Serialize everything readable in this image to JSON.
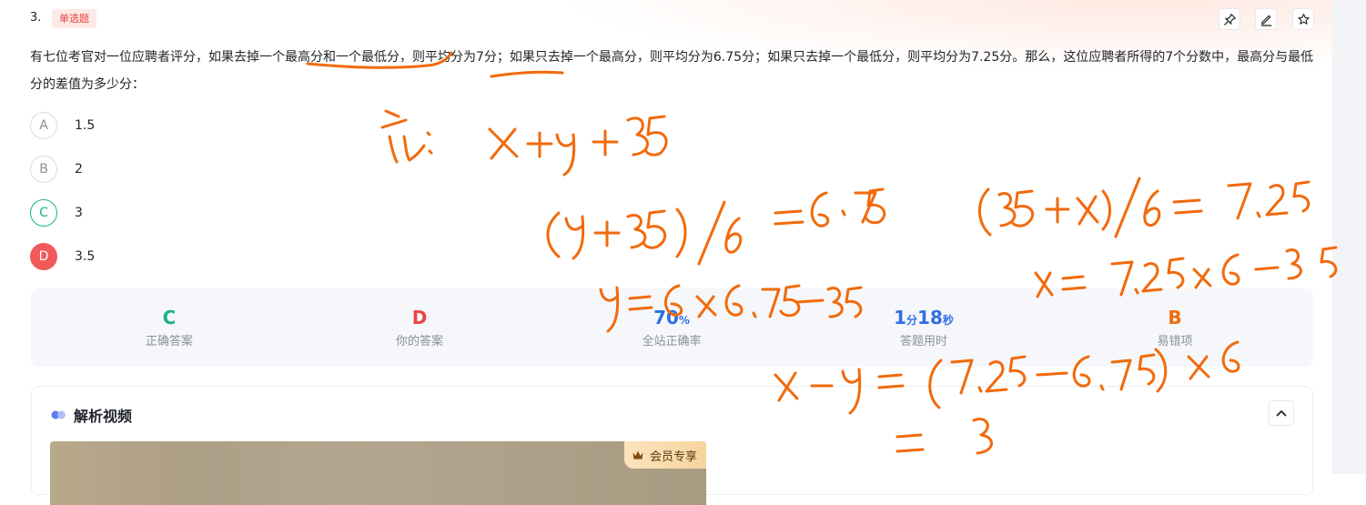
{
  "question": {
    "number": "3.",
    "type_tag": "单选题",
    "stem": "有七位考官对一位应聘者评分，如果去掉一个最高分和一个最低分，则平均分为7分；如果只去掉一个最高分，则平均分为6.75分；如果只去掉一个最低分，则平均分为7.25分。那么，这位应聘者所得的7个分数中，最高分与最低分的差值为多少分："
  },
  "toolbar": {
    "pin_icon": "pin-icon",
    "edit_icon": "edit-icon",
    "star_icon": "star-icon"
  },
  "options": [
    {
      "letter": "A",
      "text": "1.5",
      "state": "normal"
    },
    {
      "letter": "B",
      "text": "2",
      "state": "normal"
    },
    {
      "letter": "C",
      "text": "3",
      "state": "correct"
    },
    {
      "letter": "D",
      "text": "3.5",
      "state": "wrong"
    }
  ],
  "stats": {
    "correct_answer": {
      "value": "C",
      "label": "正确答案",
      "color": "#19b28a"
    },
    "your_answer": {
      "value": "D",
      "label": "你的答案",
      "color": "#ee4444"
    },
    "accuracy": {
      "value": "70",
      "unit": "%",
      "label": "全站正确率",
      "color": "#2f6fe3"
    },
    "time": {
      "min": "1",
      "min_unit": "分",
      "sec": "18",
      "sec_unit": "秒",
      "label": "答题用时",
      "color": "#2f6fe3"
    },
    "common_wrong": {
      "value": "B",
      "label": "易错项",
      "color": "#f26a0c"
    }
  },
  "video": {
    "title": "解析视频",
    "vip_badge": "会员专享"
  },
  "colors": {
    "ink": "#f26a0c",
    "tag_red": "#e5413f",
    "correct_green": "#19b28a",
    "wrong_red": "#f25a5a"
  }
}
